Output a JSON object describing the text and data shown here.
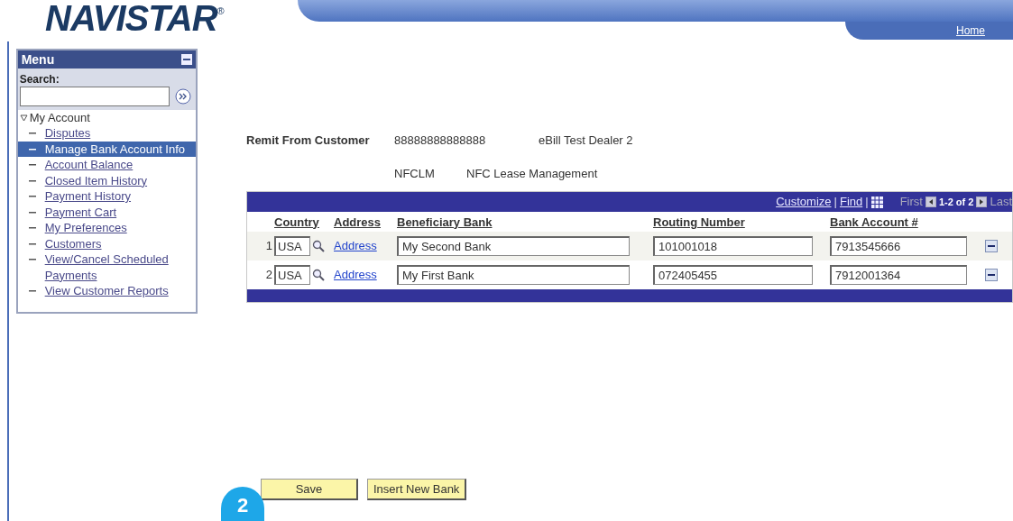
{
  "logo": {
    "text": "NAVISTAR",
    "mark": "®"
  },
  "header": {
    "home_link": "Home"
  },
  "menu": {
    "title": "Menu",
    "search_label": "Search:",
    "group": {
      "label": "My Account",
      "expanded": true,
      "items": [
        {
          "label": "Disputes",
          "selected": false
        },
        {
          "label": "Manage Bank Account Info",
          "selected": true
        },
        {
          "label": "Account Balance",
          "selected": false
        },
        {
          "label": "Closed Item History",
          "selected": false
        },
        {
          "label": "Payment History",
          "selected": false
        },
        {
          "label": "Payment Cart",
          "selected": false
        },
        {
          "label": "My Preferences",
          "selected": false
        },
        {
          "label": "Customers",
          "selected": false
        },
        {
          "label": "View/Cancel Scheduled Payments",
          "selected": false
        },
        {
          "label": "View Customer Reports",
          "selected": false
        }
      ]
    }
  },
  "customer": {
    "label": "Remit From Customer",
    "id": "88888888888888",
    "name": "eBill Test Dealer 2",
    "code": "NFCLM",
    "code_name": "NFC Lease Management"
  },
  "grid": {
    "toolbar": {
      "customize": "Customize",
      "find": "Find",
      "separator": "|",
      "first": "First",
      "range": "1-2 of 2",
      "last": "Last"
    },
    "columns": [
      "Country",
      "Address",
      "Beneficiary Bank",
      "Routing Number",
      "Bank Account #"
    ],
    "rows": [
      {
        "num": "1",
        "country": "USA",
        "address": "Address",
        "bank": "My Second Bank",
        "routing": "101001018",
        "account": "7913545666"
      },
      {
        "num": "2",
        "country": "USA",
        "address": "Address",
        "bank": "My First Bank",
        "routing": "072405455",
        "account": "7912001364"
      }
    ]
  },
  "buttons": [
    "Save",
    "Insert New Bank"
  ],
  "callout": "2"
}
